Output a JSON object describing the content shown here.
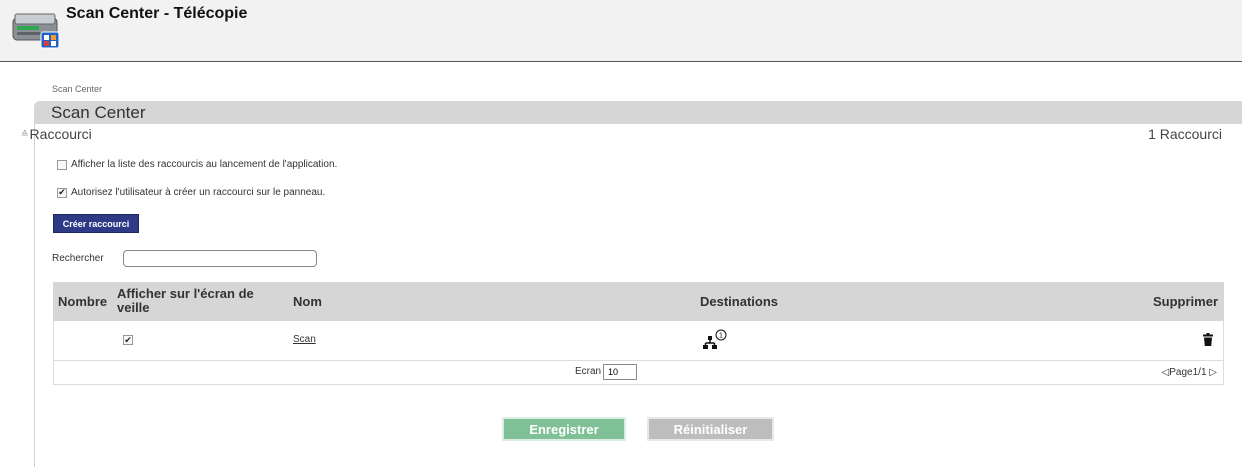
{
  "app": {
    "title": "Scan Center - Télécopie",
    "icon": "scanner-app-icon"
  },
  "breadcrumb": "Scan Center",
  "panel": {
    "title": "Scan Center",
    "section_toggle_icon": "collapse-chevron-icon",
    "section_title": "Raccourci",
    "count_label": "1 Raccourci"
  },
  "options": {
    "show_list": {
      "label": "Afficher la liste des raccourcis au lancement de l'application.",
      "checked": false
    },
    "allow_user": {
      "label": "Autorisez l'utilisateur à créer un raccourci sur le panneau.",
      "checked": true
    }
  },
  "create_button": "Créer raccourci",
  "search": {
    "label": "Rechercher",
    "value": ""
  },
  "table": {
    "headers": {
      "number": "Nombre",
      "show_standby": "Afficher sur l'écran de veille",
      "name": "Nom",
      "destinations": "Destinations",
      "delete": "Supprimer"
    },
    "rows": [
      {
        "number": "",
        "show_standby": true,
        "name": "Scan",
        "destinations_icon": "network-destination-icon",
        "destinations_count": "1",
        "delete_icon": "trash-icon"
      }
    ],
    "footer": {
      "screen_label": "Ecran",
      "screen_value": "10",
      "prev_icon": "◁",
      "page_label": "Page1/1",
      "next_icon": "▷"
    }
  },
  "actions": {
    "save": "Enregistrer",
    "reset": "Réinitialiser"
  },
  "colors": {
    "create_button": "#2e3a85",
    "save_button": "#7fc097",
    "reset_button": "#bdbdbd",
    "header_bg": "#d6d6d6"
  }
}
